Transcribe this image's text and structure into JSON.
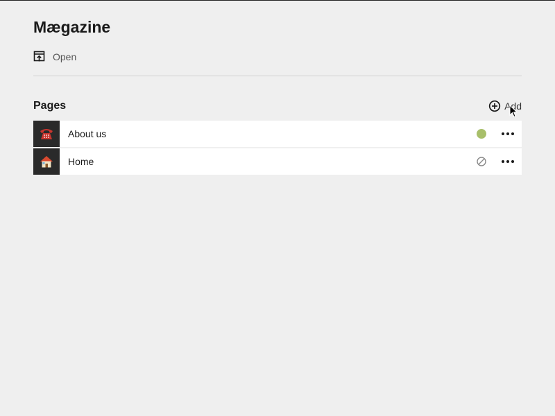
{
  "site": {
    "title": "Mægazine",
    "open_label": "Open"
  },
  "pages_section": {
    "title": "Pages",
    "add_label": "Add"
  },
  "pages": [
    {
      "title": "About us",
      "thumb_icon": "telephone-icon",
      "status": "published",
      "status_color": "#a8bf6a"
    },
    {
      "title": "Home",
      "thumb_icon": "house-icon",
      "status": "draft",
      "status_icon": "draft-status-icon"
    }
  ],
  "colors": {
    "background": "#efefef",
    "row_background": "#ffffff",
    "published": "#a8bf6a"
  }
}
